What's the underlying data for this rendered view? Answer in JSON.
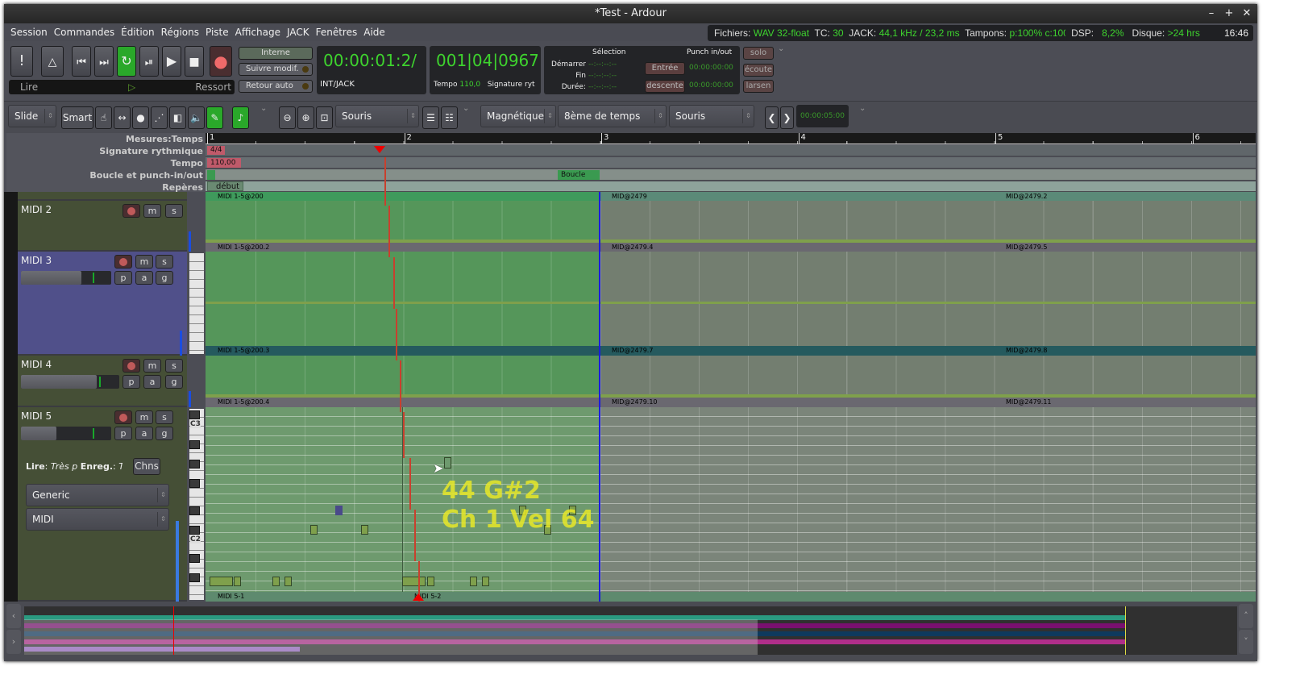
{
  "window": {
    "title": "*Test - Ardour",
    "controls": [
      "–",
      "+",
      "✕"
    ]
  },
  "menu": [
    "Session",
    "Commandes",
    "Édition",
    "Régions",
    "Piste",
    "Affichage",
    "JACK",
    "Fenêtres",
    "Aide"
  ],
  "status": {
    "files_label": "Fichiers:",
    "files_value": "WAV 32-float",
    "tc_label": "TC:",
    "tc_value": "30",
    "jack_label": "JACK:",
    "jack_value": "44,1 kHz / 23,2 ms",
    "buffers_label": "Tampons:",
    "buffers_value": "p:100% c:100%",
    "dsp_label": "DSP:",
    "dsp_value": "8,2%",
    "disk_label": "Disque:",
    "disk_value": ">24 hrs",
    "time": "16:46"
  },
  "transport": {
    "play_mode_left": "Lire",
    "play_mode_right": "Ressort",
    "sync": "Interne",
    "follow_edits": "Suivre modif.",
    "auto_return": "Retour auto",
    "primary_clock": "00:00:01:2/",
    "primary_clock_source": "INT/JACK",
    "secondary_clock": "001|04|0967",
    "tempo_label": "Tempo",
    "tempo_value": "110,0",
    "signature_label": "Signature ryt",
    "selection_title": "Sélection",
    "start_label": "Démarrer",
    "end_label": "Fin",
    "duration_label": "Durée:",
    "empty_time": "--:--:--:--",
    "punch_title": "Punch in/out",
    "punch_in": "Entrée",
    "punch_out": "descente",
    "punch_in_time": "00:00:00:00",
    "punch_out_time": "00:00:00:00",
    "solo": "solo",
    "listen": "écoute",
    "feedback": "larsen"
  },
  "toolbar": {
    "edit_mode": "Slide",
    "smart": "Smart",
    "zoom_focus": "Souris",
    "snap_mode": "Magnétique",
    "grid": "8ème de temps",
    "edit_point": "Souris",
    "nudge_clock": "00:00:05:00"
  },
  "rulers": {
    "labels": [
      "Mesures:Temps",
      "Signature rythmique",
      "Tempo",
      "Boucle et punch-in/out",
      "Repères"
    ],
    "bars": [
      "1",
      "2",
      "3",
      "4",
      "5",
      "6"
    ],
    "meter": "4/4",
    "tempo": "110,00",
    "loop": "Boucle",
    "marker": "début"
  },
  "tracks": [
    {
      "name": "MIDI 2",
      "buttons": [
        "m",
        "s"
      ]
    },
    {
      "name": "MIDI 3",
      "buttons": [
        "m",
        "s",
        "p",
        "a",
        "g"
      ],
      "gain": 0.72
    },
    {
      "name": "MIDI 4",
      "buttons": [
        "m",
        "s",
        "p",
        "a",
        "g"
      ],
      "gain": 0.78
    },
    {
      "name": "MIDI 5",
      "buttons": [
        "m",
        "s",
        "p",
        "a",
        "g"
      ],
      "gain": 0.38,
      "play_label": "Lire",
      "play_value": "Très p",
      "rec_label": "Enreg.",
      "rec_value": "Tr",
      "chns": "Chns",
      "device": "Generic",
      "mode": "MIDI",
      "key_c3": "C3",
      "key_c2": "C2"
    }
  ],
  "regions": {
    "r0": [
      "MIDI 1-5@200",
      "MID@2479",
      "MID@2479.2"
    ],
    "r1": [
      "MIDI 1-5@200.2",
      "MID@2479.4",
      "MID@2479.5"
    ],
    "r2": [
      "MIDI 1-5@200.3",
      "MID@2479.7",
      "MID@2479.8"
    ],
    "r3": [
      "MIDI 1-5@200.4",
      "MID@2479.10",
      "MID@2479.11"
    ],
    "r4": [
      "MIDI 5-1",
      "MIDI 5-2"
    ]
  },
  "note_tooltip": {
    "line1": "44 G#2",
    "line2": "Ch 1 Vel 64"
  },
  "colors": {
    "region_green": "#55965a",
    "region_grey": "#737e70",
    "playhead": "#c8402e",
    "edit_point": "#1a1ae0",
    "clock_green": "#3ed32e",
    "selected_track": "#50508a"
  }
}
